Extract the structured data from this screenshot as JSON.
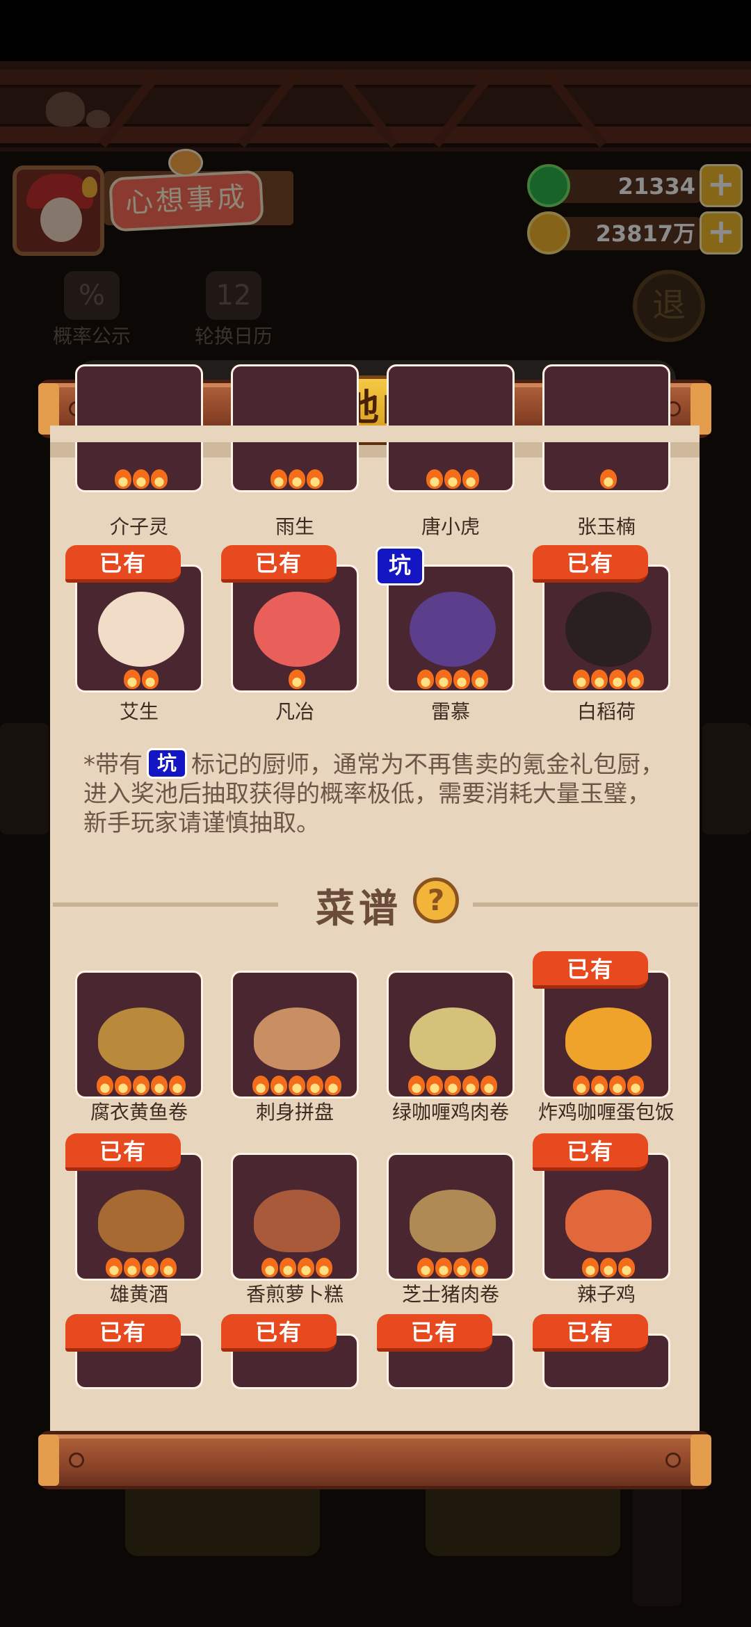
{
  "header": {
    "player_title": "心想事成",
    "jade_amount": "21334",
    "coin_amount": "23817万",
    "plus_label": "+",
    "sub_buttons": [
      {
        "label": "概率公示",
        "icon_text": "%"
      },
      {
        "label": "轮换日历",
        "icon_text": "12"
      }
    ],
    "exit_label": "退"
  },
  "modal": {
    "title": "奖池内容",
    "chef_rows": [
      [
        {
          "name": "介子灵",
          "stars": 3
        },
        {
          "name": "雨生",
          "stars": 3
        },
        {
          "name": "唐小虎",
          "stars": 3
        },
        {
          "name": "张玉楠",
          "stars": 1
        }
      ],
      [
        {
          "name": "艾生",
          "stars": 2,
          "badge": "已有",
          "art": "#f1dcc8"
        },
        {
          "name": "凡冶",
          "stars": 1,
          "badge": "已有",
          "art": "#e9605a"
        },
        {
          "name": "雷慕",
          "stars": 4,
          "badge": "坑",
          "art": "#5b3f8c"
        },
        {
          "name": "白稻荷",
          "stars": 4,
          "badge": "已有",
          "art": "#2b2020"
        }
      ]
    ],
    "note": {
      "prefix": "*带有",
      "badge": "坑",
      "suffix": "标记的厨师，通常为不再售卖的氪金礼包厨，进入奖池后抽取获得的概率极低，需要消耗大量玉璧，新手玩家请谨慎抽取。"
    },
    "recipes_title": "菜谱",
    "help_label": "?",
    "recipe_rows": [
      [
        {
          "name": "腐衣黄鱼卷",
          "stars": 5,
          "art": "#b98a3c"
        },
        {
          "name": "刺身拼盘",
          "stars": 5,
          "art": "#c98f63"
        },
        {
          "name": "绿咖喱鸡肉卷",
          "stars": 5,
          "art": "#d4c27a"
        },
        {
          "name": "炸鸡咖喱蛋包饭",
          "stars": 4,
          "badge": "已有",
          "art": "#f0a32a"
        }
      ],
      [
        {
          "name": "雄黄酒",
          "stars": 4,
          "badge": "已有",
          "art": "#a86a33"
        },
        {
          "name": "香煎萝卜糕",
          "stars": 4,
          "art": "#a95a3a"
        },
        {
          "name": "芝士猪肉卷",
          "stars": 4,
          "art": "#b08a55"
        },
        {
          "name": "辣子鸡",
          "stars": 3,
          "badge": "已有",
          "art": "#e0683a"
        }
      ]
    ],
    "bottom_badges": [
      "已有",
      "已有",
      "已有",
      "已有"
    ]
  },
  "colors": {
    "owned_badge": "#e84a1f",
    "pit_badge": "#1416c4",
    "tile_bg": "#4a2630",
    "paper": "#e7d5bd",
    "plaque": "#f6c846"
  }
}
